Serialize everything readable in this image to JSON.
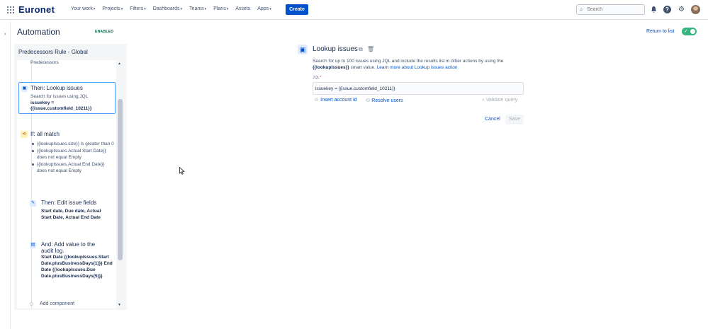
{
  "app": {
    "logo": "Euronet"
  },
  "nav": {
    "items": [
      "Your work",
      "Projects",
      "Filters",
      "Dashboards",
      "Teams",
      "Plans",
      "Assets",
      "Apps"
    ],
    "create_label": "Create",
    "search_placeholder": "Search"
  },
  "header": {
    "title": "Automation",
    "status_badge": "ENABLED",
    "return_link": "Return to list",
    "rule_enabled": true
  },
  "rule": {
    "title": "Predecessors Rule - Global",
    "predecessors_text": "Predecessors",
    "lookup": {
      "title": "Then: Lookup issues",
      "desc": "Search for issues using JQL",
      "jql_line1": "issuekey =",
      "jql_line2": "{{issue.customfield_10211}}"
    },
    "if": {
      "title": "If: all match",
      "conditions": [
        "{{lookupIssues.size}} is greater than 0",
        "{{lookupIssues.Actual Start Date}} does not equal Empty",
        "{{lookupIssues.Actual End Date}} does not equal Empty"
      ]
    },
    "edit": {
      "title": "Then: Edit issue fields",
      "fields_line1": "Start date, Due date, Actual",
      "fields_line2": "Start Date, Actual End Date"
    },
    "audit": {
      "title_line1": "And: Add value to the",
      "title_line2": "audit log.",
      "value_lines": [
        "Start Date {{lookupIssues.Start",
        "Date.plusBusinessDays(1)}} End",
        "Date {{lookupIssues.Due",
        "Date.plusBusinessDays(5)}}"
      ]
    },
    "add_component": "Add component"
  },
  "detail": {
    "title": "Lookup issues",
    "desc_line1": "Search for up to 100 issues using JQL and include the results list in other actions by using the",
    "desc_smart": "{{lookupIssues}}",
    "desc_mid": " smart value. ",
    "desc_link": "Learn more about Lookup issues action",
    "jql_label": "JQL",
    "jql_value": "issuekey = {{issue.customfield_10211}}",
    "insert_account": "Insert account id",
    "resolve_users": "Resolve users",
    "validate_query": "Validate query",
    "cancel": "Cancel",
    "save": "Save"
  },
  "colors": {
    "primary": "#0052cc",
    "enabled": "#36b37e",
    "text": "#172b4d"
  }
}
